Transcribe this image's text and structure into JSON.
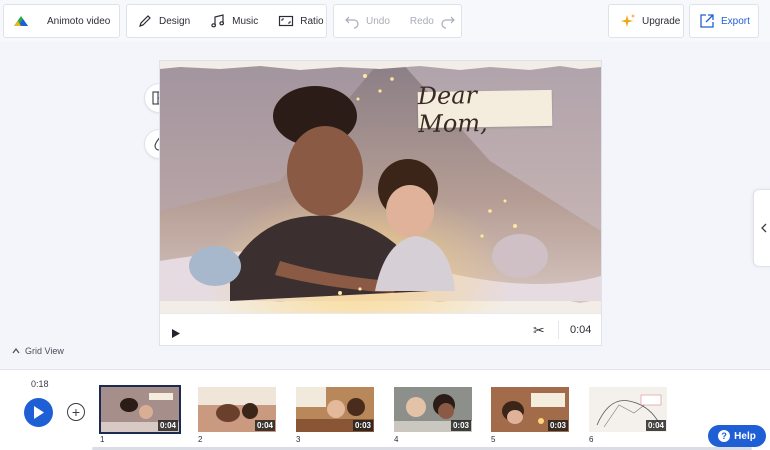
{
  "toolbar": {
    "project_name": "Animoto video",
    "design_label": "Design",
    "music_label": "Music",
    "ratio_label": "Ratio",
    "undo_label": "Undo",
    "redo_label": "Redo",
    "upgrade_label": "Upgrade",
    "export_label": "Export"
  },
  "preview": {
    "overlay_text": "Dear Mom,",
    "duration": "0:04"
  },
  "timeline": {
    "grid_view_label": "Grid View",
    "elapsed": "0:18",
    "clips": [
      {
        "number": "1",
        "duration": "0:04",
        "selected": true
      },
      {
        "number": "2",
        "duration": "0:04",
        "selected": false
      },
      {
        "number": "3",
        "duration": "0:03",
        "selected": false
      },
      {
        "number": "4",
        "duration": "0:03",
        "selected": false
      },
      {
        "number": "5",
        "duration": "0:03",
        "selected": false
      },
      {
        "number": "6",
        "duration": "0:04",
        "selected": false
      }
    ]
  },
  "help": {
    "label": "Help"
  },
  "colors": {
    "accent": "#1f5fd6",
    "upgrade_star": "#f0a81c",
    "selected_outline": "#1d2b52"
  },
  "icons": {
    "logo": "animoto-logo-icon",
    "design": "pen-icon",
    "music": "music-note-icon",
    "ratio": "aspect-ratio-icon",
    "undo": "undo-icon",
    "redo": "redo-icon",
    "upgrade": "sparkle-icon",
    "export": "export-icon",
    "layout": "layout-icon",
    "color": "droplet-icon",
    "scissors": "scissors-icon",
    "panel": "chevron-left-icon"
  }
}
